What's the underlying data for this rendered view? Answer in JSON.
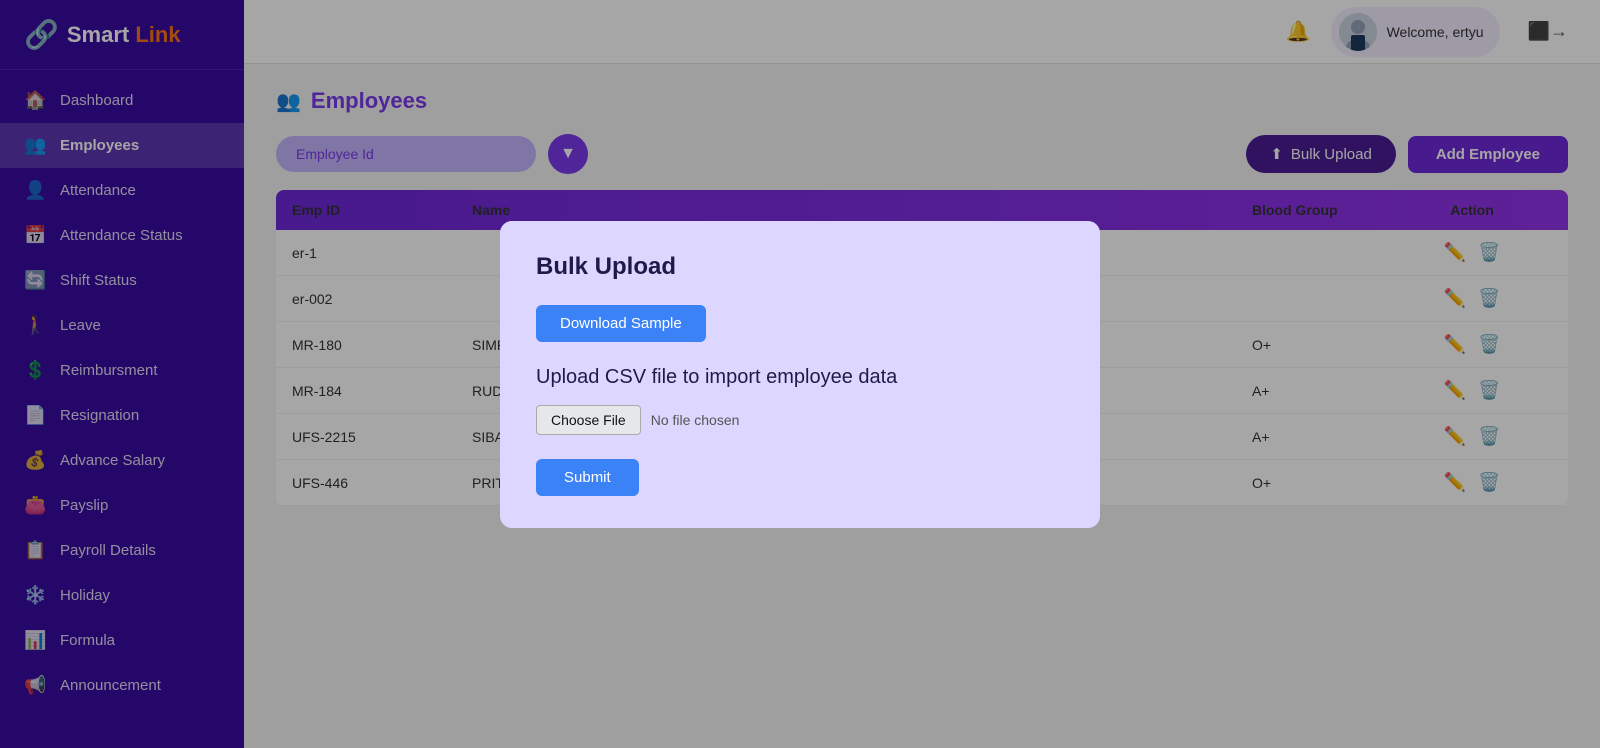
{
  "app": {
    "name": "Smart",
    "nameHighlight": "Link"
  },
  "header": {
    "welcomeText": "Welcome, ertyu"
  },
  "sidebar": {
    "items": [
      {
        "id": "dashboard",
        "label": "Dashboard",
        "icon": "🏠"
      },
      {
        "id": "employees",
        "label": "Employees",
        "icon": "👥",
        "active": true
      },
      {
        "id": "attendance",
        "label": "Attendance",
        "icon": "👤"
      },
      {
        "id": "attendance-status",
        "label": "Attendance Status",
        "icon": "📅"
      },
      {
        "id": "shift-status",
        "label": "Shift Status",
        "icon": "🔄"
      },
      {
        "id": "leave",
        "label": "Leave",
        "icon": "🚶"
      },
      {
        "id": "reimbursement",
        "label": "Reimbursment",
        "icon": "💲"
      },
      {
        "id": "resignation",
        "label": "Resignation",
        "icon": "📄"
      },
      {
        "id": "advance-salary",
        "label": "Advance Salary",
        "icon": "💰"
      },
      {
        "id": "payslip",
        "label": "Payslip",
        "icon": "👛"
      },
      {
        "id": "payroll-details",
        "label": "Payroll Details",
        "icon": "📋"
      },
      {
        "id": "holiday",
        "label": "Holiday",
        "icon": "❄️"
      },
      {
        "id": "formula",
        "label": "Formula",
        "icon": "📊"
      },
      {
        "id": "announcement",
        "label": "Announcement",
        "icon": "📢"
      }
    ]
  },
  "page": {
    "title": "Employees",
    "search_placeholder": "Employee Id"
  },
  "toolbar": {
    "bulk_upload_label": "Bulk Upload",
    "add_employee_label": "Add Employee"
  },
  "table": {
    "headers": [
      "Emp ID",
      "Name",
      "Blood Group",
      "Action"
    ],
    "rows": [
      {
        "emp_id": "er-1",
        "name": "",
        "blood_group": "",
        "actions": true
      },
      {
        "emp_id": "er-002",
        "name": "",
        "blood_group": "",
        "actions": true
      },
      {
        "emp_id": "MR-180",
        "name": "SIMRAN MISHRA",
        "blood_group": "O+",
        "actions": true
      },
      {
        "emp_id": "MR-184",
        "name": "RUDRA MISHRA",
        "blood_group": "A+",
        "actions": true
      },
      {
        "emp_id": "UFS-2215",
        "name": "SIBAPRASAD MOHANTY",
        "blood_group": "A+",
        "actions": true
      },
      {
        "emp_id": "UFS-446",
        "name": "PRITICHHANDA SWAIN",
        "blood_group": "O+",
        "actions": true
      }
    ]
  },
  "modal": {
    "title": "Bulk Upload",
    "download_sample_label": "Download Sample",
    "upload_description": "Upload CSV file to import employee data",
    "choose_file_label": "Choose File",
    "no_file_text": "No file chosen",
    "submit_label": "Submit"
  }
}
